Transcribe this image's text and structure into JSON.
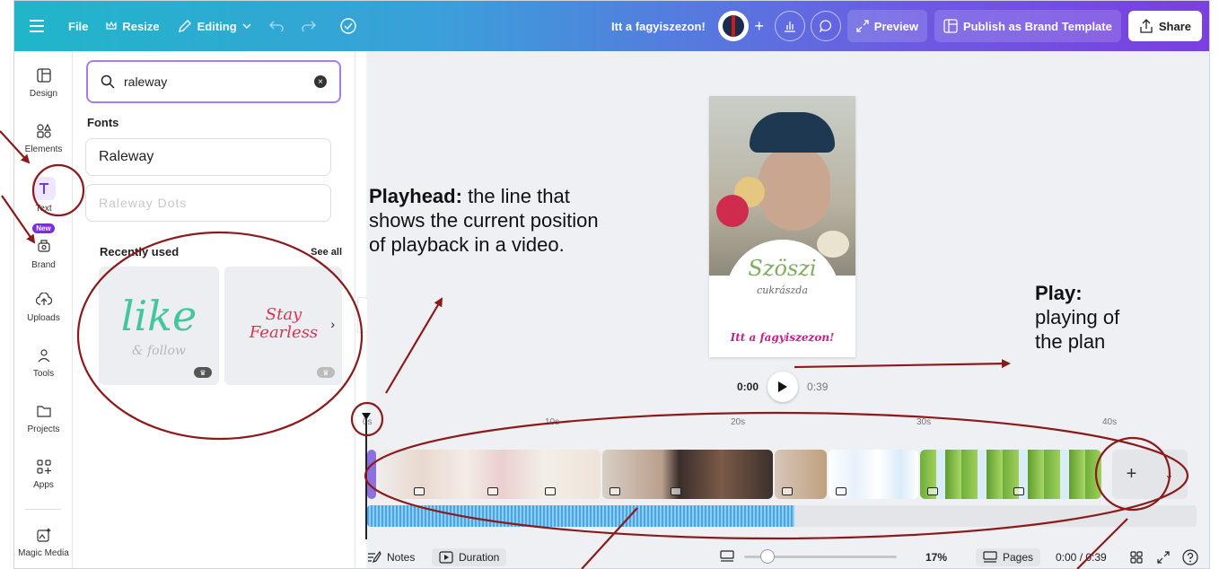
{
  "topbar": {
    "file": "File",
    "resize": "Resize",
    "editing": "Editing",
    "doc_title": "Itt a fagyiszezon!",
    "preview": "Preview",
    "publish": "Publish as Brand Template",
    "share": "Share",
    "colors": {
      "gradient_start": "#1fb6c9",
      "gradient_end": "#7a3fe0"
    }
  },
  "rail": {
    "items": [
      {
        "label": "Design",
        "icon": "design-icon"
      },
      {
        "label": "Elements",
        "icon": "elements-icon"
      },
      {
        "label": "Text",
        "icon": "text-icon"
      },
      {
        "label": "Brand",
        "icon": "brand-icon",
        "badge": "New"
      },
      {
        "label": "Uploads",
        "icon": "upload-icon"
      },
      {
        "label": "Tools",
        "icon": "tools-icon"
      },
      {
        "label": "Projects",
        "icon": "folder-icon"
      },
      {
        "label": "Apps",
        "icon": "apps-icon"
      },
      {
        "label": "Magic Media",
        "icon": "magic-media-icon"
      }
    ]
  },
  "panel": {
    "search_value": "raleway",
    "fonts_heading": "Fonts",
    "fonts": [
      "Raleway",
      "Raleway Dots"
    ],
    "recently_used": "Recently used",
    "see_all": "See all",
    "recent": [
      {
        "main": "like",
        "sub": "& follow"
      },
      {
        "main": "Stay Fearless"
      }
    ]
  },
  "poster": {
    "logo_main": "Szöszi",
    "logo_sub": "cukrászda",
    "slogan": "Itt a fagyiszezon!"
  },
  "player": {
    "current": "0:00",
    "total": "0:39"
  },
  "timeline": {
    "ticks": [
      "0s",
      "10s",
      "20s",
      "30s",
      "40s"
    ]
  },
  "bottombar": {
    "notes": "Notes",
    "duration": "Duration",
    "zoom": "17%",
    "pages": "Pages",
    "time": "0:00 / 0:39"
  },
  "annotations": {
    "playhead_title": "Playhead:",
    "playhead_text_1": "the line that",
    "playhead_text_2": "shows the current position",
    "playhead_text_3": "of playback in a video.",
    "play_title": "Play:",
    "play_text_1": "playing of",
    "play_text_2": "the plan"
  }
}
